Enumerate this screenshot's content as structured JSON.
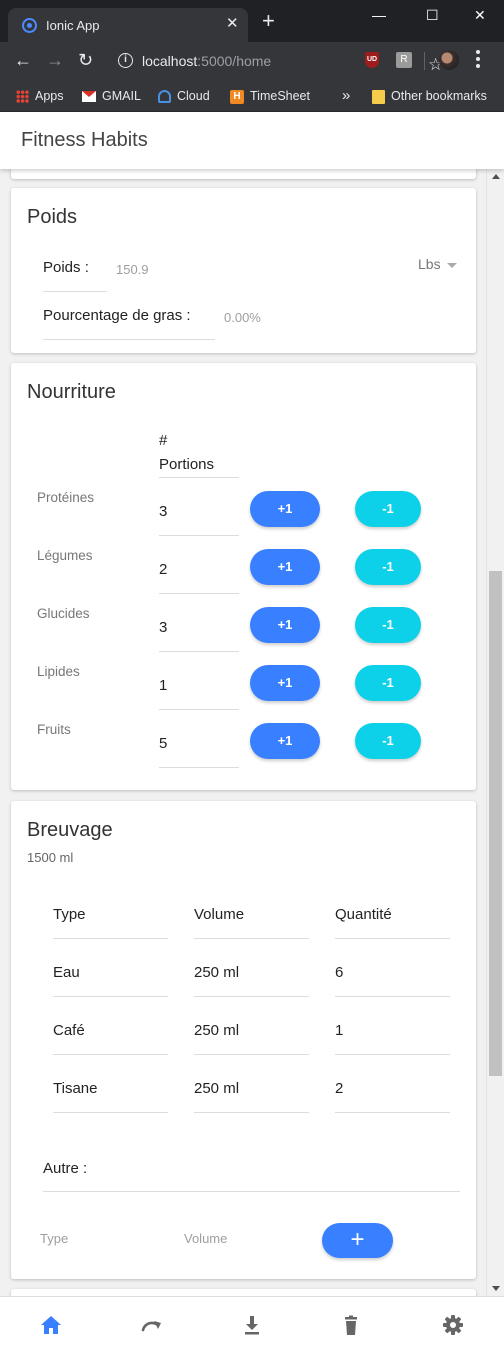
{
  "browser": {
    "tab_title": "Ionic App",
    "tab_close": "✕",
    "new_tab": "+",
    "url_host": "localhost",
    "url_rest": ":5000/home",
    "window_minimize": "—",
    "window_maximize": "☐",
    "window_close": "✕",
    "ext_ublock": "UD",
    "ext_r": "R",
    "bookmarks": [
      "Apps",
      "GMAIL",
      "Cloud",
      "TimeSheet"
    ],
    "bookmarks_overflow": "»",
    "other_bookmarks": "Other bookmarks",
    "timesheet_icon": "H"
  },
  "app": {
    "title": "Fitness Habits"
  },
  "poids": {
    "title": "Poids",
    "poids_label": "Poids :",
    "poids_value": "150.9",
    "unit": "Lbs",
    "gras_label": "Pourcentage de gras :",
    "gras_value": "0.00%"
  },
  "nourriture": {
    "title": "Nourriture",
    "header_hash": "#",
    "header_portions": "Portions",
    "plus_label": "+1",
    "minus_label": "-1",
    "rows": [
      {
        "label": "Protéines",
        "value": "3"
      },
      {
        "label": "Légumes",
        "value": "2"
      },
      {
        "label": "Glucides",
        "value": "3"
      },
      {
        "label": "Lipides",
        "value": "1"
      },
      {
        "label": "Fruits",
        "value": "5"
      }
    ]
  },
  "breuvage": {
    "title": "Breuvage",
    "total": "1500 ml",
    "headers": [
      "Type",
      "Volume",
      "Quantité"
    ],
    "rows": [
      [
        "Eau",
        "250 ml",
        "6"
      ],
      [
        "Café",
        "250 ml",
        "1"
      ],
      [
        "Tisane",
        "250 ml",
        "2"
      ]
    ],
    "autre_label": "Autre :",
    "type_placeholder": "Type",
    "volume_placeholder": "Volume",
    "add_label": "+"
  },
  "tabbar": {
    "items": [
      "home-icon",
      "redo-icon",
      "download-icon",
      "trash-icon",
      "settings-icon"
    ],
    "active_color": "#3880ff",
    "inactive_color": "#666666"
  }
}
